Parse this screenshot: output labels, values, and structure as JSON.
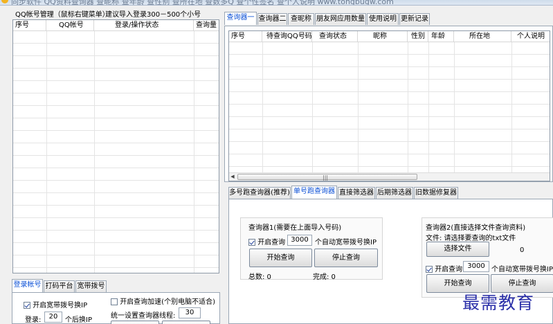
{
  "window": {
    "title": "同步软件 QQ资料查询器 查昵称 查年龄 查性别 查所在地 查数多Q 查个性签名 查个人说明 www.tongbugw.com"
  },
  "left": {
    "header_label": "QQ帐号管理（鼠标右键菜单）",
    "header_hint": "建议导入登录300－500个小号",
    "account_table": {
      "columns": [
        "序号",
        "QQ帐号",
        "登录/操作状态",
        "查询量"
      ]
    },
    "bottom_tabs": [
      "登录帐号",
      "打码平台",
      "宽带拨号"
    ],
    "login_panel": {
      "broadband_checkbox_label": "开启宽带拨号换IP",
      "speedup_checkbox_label": "开启查询加速(个别电脑不适合)",
      "login_label": "登录:",
      "login_value": "20",
      "login_suffix": "个后换IP",
      "threads_label": "统一设置查询器线程:",
      "threads_value": "30"
    }
  },
  "right": {
    "top_tabs": [
      "查询器一",
      "查询器二",
      "查昵称",
      "朋友网应用数量",
      "使用说明",
      "更新记录"
    ],
    "result_table": {
      "columns": [
        "序号",
        "待查询QQ号码",
        "查询状态",
        "昵称",
        "性别",
        "年龄",
        "所在地",
        "个人说明"
      ]
    },
    "sub_tabs": [
      "多号跑查询器(推荐)",
      "单号跑查询器",
      "直接筛选器",
      "后期筛选器",
      "旧数据修复器"
    ],
    "query1": {
      "title": "查询器1(需要在上面导入号码)",
      "checkbox_label": "开启查询",
      "value": "3000",
      "suffix": "个自动宽带拨号换IP",
      "start_button": "开始查询",
      "stop_button": "停止查询",
      "total_label": "总数: 0",
      "done_label": "完成: 0"
    },
    "query2": {
      "title": "查询器2(直接选择文件查询资料)",
      "file_label": "文件: 请选择要查询的txt文件",
      "choose_button": "选择文件",
      "count_value": "0",
      "checkbox_label": "开启查询",
      "value": "3000",
      "suffix": "个自动宽带拨号换IP",
      "start_button": "开始查询",
      "stop_button": "停止查询"
    }
  },
  "watermark": "最需教育",
  "colors": {
    "accent": "#0a4fd6",
    "watermark": "#2a2fa8"
  }
}
